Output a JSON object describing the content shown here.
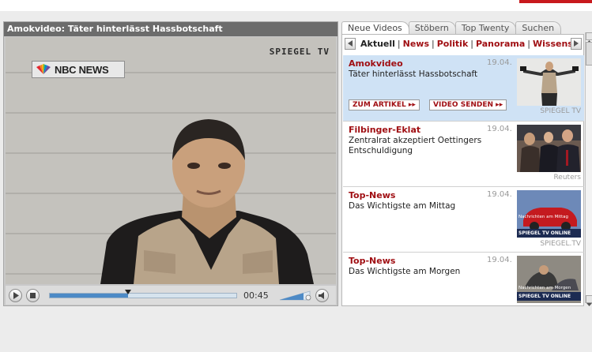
{
  "video": {
    "title": "Amokvideo: Täter hinterlässt Hassbotschaft",
    "nbc_logo_text": "NBC NEWS",
    "watermark": "SPIEGEL TV",
    "time": "00:45",
    "progress_fraction": 0.42,
    "buffered_fraction": 1.0
  },
  "tabs": [
    {
      "label": "Neue Videos",
      "active": true
    },
    {
      "label": "Stöbern",
      "active": false
    },
    {
      "label": "Top Twenty",
      "active": false
    },
    {
      "label": "Suchen",
      "active": false
    }
  ],
  "categories": [
    {
      "label": "Aktuell",
      "current": true
    },
    {
      "label": "News",
      "current": false
    },
    {
      "label": "Politik",
      "current": false
    },
    {
      "label": "Panorama",
      "current": false
    },
    {
      "label": "Wissenschaft",
      "current": false
    }
  ],
  "items": [
    {
      "kicker": "Amokvideo",
      "date": "19.04.",
      "desc": "Täter hinterlässt Hassbotschaft",
      "credit": "SPIEGEL TV",
      "selected": true,
      "btn_article": "ZUM ARTIKEL",
      "btn_send": "VIDEO SENDEN"
    },
    {
      "kicker": "Filbinger-Eklat",
      "date": "19.04.",
      "desc": "Zentralrat akzeptiert Oettingers Entschuldigung",
      "credit": "Reuters"
    },
    {
      "kicker": "Top-News",
      "date": "19.04.",
      "desc": "Das Wichtigste am Mittag",
      "credit": "SPIEGEL.TV",
      "thumb_caption_top": "Nachrichten am Mittag",
      "thumb_caption_bottom": "SPIEGEL TV ONLINE"
    },
    {
      "kicker": "Top-News",
      "date": "19.04.",
      "desc": "Das Wichtigste am Morgen",
      "thumb_caption_top": "Nachrichten am Morgen",
      "thumb_caption_bottom": "SPIEGEL TV ONLINE"
    }
  ],
  "colors": {
    "accent_red": "#a00f13",
    "selected_bg": "#cfe2f5",
    "progress_blue": "#4d8ac6"
  }
}
